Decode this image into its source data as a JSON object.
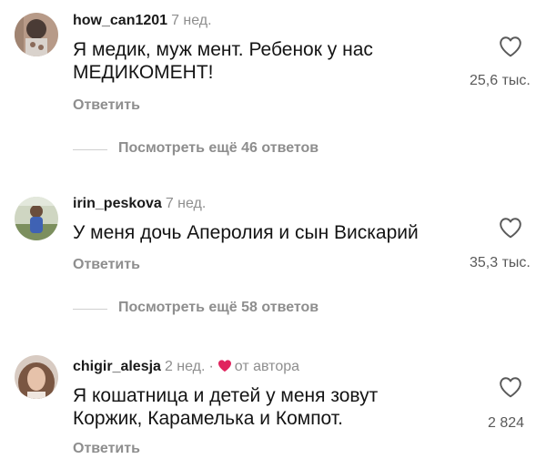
{
  "comments": [
    {
      "username": "how_can1201",
      "time": "7 нед.",
      "text": "Я медик, муж мент. Ребенок у нас МЕДИКОМЕНТ!",
      "reply_label": "Ответить",
      "likes": "25,6 тыс.",
      "view_more": "Посмотреть ещё 46 ответов"
    },
    {
      "username": "irin_peskova",
      "time": "7 нед.",
      "text": "У меня дочь Аперолия и сын Вискарий",
      "reply_label": "Ответить",
      "likes": "35,3 тыс.",
      "view_more": "Посмотреть ещё 58 ответов"
    },
    {
      "username": "chigir_alesja",
      "time": "2 нед.",
      "separator": "·",
      "author_badge": "от автора",
      "text": "Я кошатница и детей у меня зовут Коржик, Карамелька и Компот.",
      "reply_label": "Ответить",
      "likes": "2 824"
    }
  ],
  "colors": {
    "text": "#141414",
    "secondary": "#8e8e8e",
    "heart_red": "#e0245e",
    "divider": "#cfcfcf"
  },
  "icons": [
    "heart-outline-icon",
    "heart-filled-icon"
  ]
}
